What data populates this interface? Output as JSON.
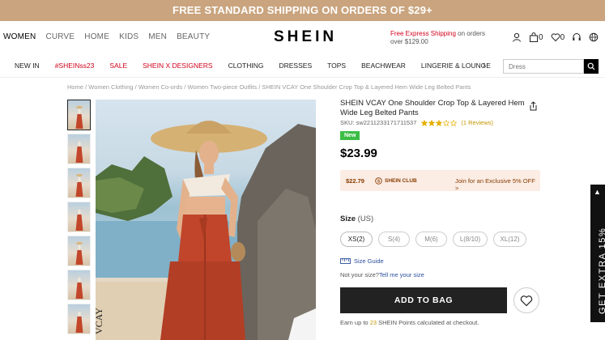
{
  "promo": {
    "text": "FREE STANDARD SHIPPING ON ORDERS OF $29+"
  },
  "header": {
    "gender_nav": [
      "WOMEN",
      "CURVE",
      "HOME",
      "KIDS",
      "MEN",
      "BEAUTY"
    ],
    "logo": "SHEIN",
    "express": {
      "highlight": "Free Express Shipping",
      "rest": " on orders over $129.00"
    },
    "bag_count": "0",
    "wish_count": "0"
  },
  "category_nav": {
    "items": [
      {
        "label": "NEW IN",
        "red": false
      },
      {
        "label": "#SHEINss23",
        "red": true
      },
      {
        "label": "SALE",
        "red": true
      },
      {
        "label": "SHEIN X DESIGNERS",
        "red": true
      },
      {
        "label": "CLOTHING",
        "red": false
      },
      {
        "label": "DRESSES",
        "red": false
      },
      {
        "label": "TOPS",
        "red": false
      },
      {
        "label": "BEACHWEAR",
        "red": false
      },
      {
        "label": "LINGERIE & LOUNGE",
        "red": false
      }
    ],
    "search_placeholder": "Dress"
  },
  "breadcrumb": "Home / Women Clothing / Women Co-ords / Women Two-piece Outfits / SHEIN VCAY One Shoulder Crop Top & Layered Hem Wide Leg Belted Pants",
  "product": {
    "title": "SHEIN VCAY One Shoulder Crop Top & Layered Hem Wide Leg Belted Pants",
    "sku": "SKU: sw2211233171711537",
    "rating": 3,
    "reviews": "(1 Reviews)",
    "badge": "New",
    "price": "$23.99",
    "club": {
      "price": "$22.79",
      "logo": "SHEIN CLUB",
      "join": "Join for an Exclusive 5% OFF >"
    },
    "size_label": "Size",
    "size_unit": "(US)",
    "sizes": [
      "XS(2)",
      "S(4)",
      "M(6)",
      "L(8/10)",
      "XL(12)"
    ],
    "size_guide": "Size Guide",
    "not_sure": "Not your size?",
    "tell_me": "Tell me your size",
    "add_to_bag": "ADD TO BAG",
    "points_prefix": "Earn up to ",
    "points_num": "23",
    "points_suffix": " SHEIN Points calculated at checkout."
  },
  "side_tab": {
    "text": "GET EXTRA 15%"
  },
  "colors": {
    "promo_bg": "#c9a47e",
    "sale_red": "#d0021b",
    "new_green": "#3cbd45",
    "club_bg": "#fbece4",
    "star_gold": "#e5b000",
    "link_blue": "#2a4f9c"
  }
}
